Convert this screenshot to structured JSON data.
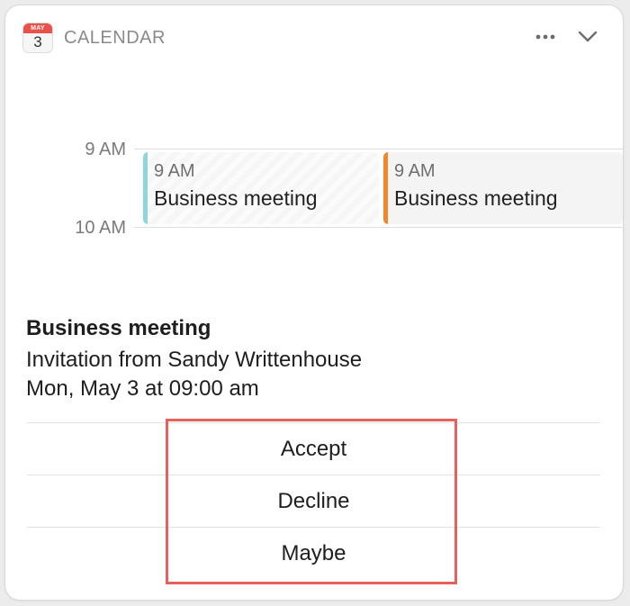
{
  "header": {
    "icon_month": "MAY",
    "icon_day": "3",
    "title": "CALENDAR"
  },
  "timeline": {
    "labels": [
      "9 AM",
      "10 AM"
    ]
  },
  "events": [
    {
      "time": "9 AM",
      "title": "Business meeting",
      "color": "#8fd6dc"
    },
    {
      "time": "9 AM",
      "title": "Business meeting",
      "color": "#f0882a"
    }
  ],
  "invitation": {
    "title": "Business meeting",
    "from": "Invitation from Sandy Writtenhouse",
    "when": "Mon, May 3 at 09:00 am"
  },
  "actions": {
    "accept": "Accept",
    "decline": "Decline",
    "maybe": "Maybe"
  },
  "colors": {
    "highlight": "#e8605a",
    "icon_header": "#e8524a"
  }
}
